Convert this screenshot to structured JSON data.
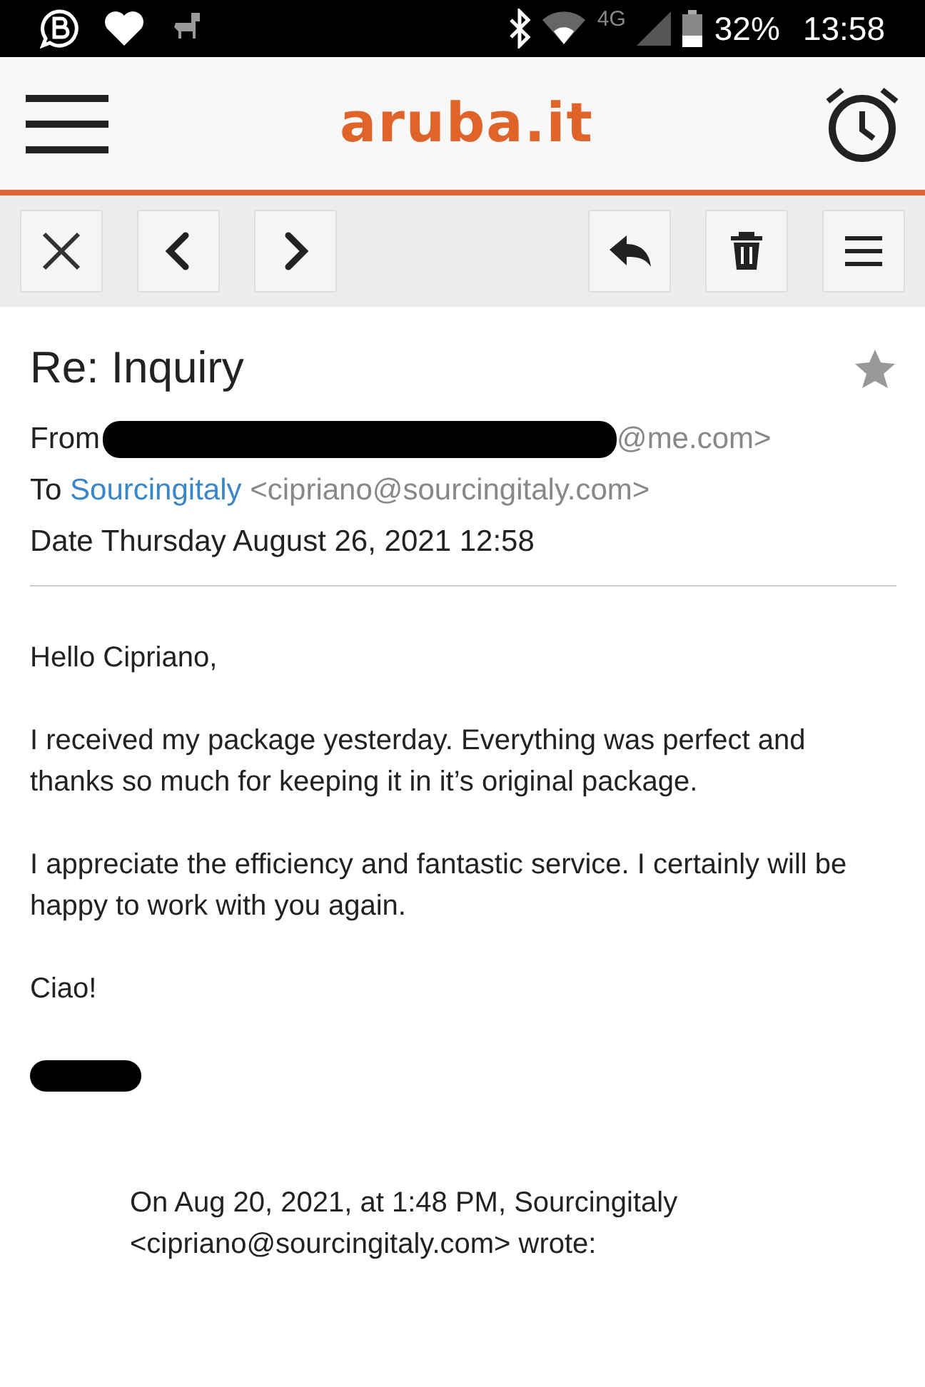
{
  "status_bar": {
    "battery": "32%",
    "time": "13:58",
    "network": "4G"
  },
  "header": {
    "logo": "aruba.it"
  },
  "toolbar": {
    "left": [
      {
        "kind": "close"
      },
      {
        "kind": "prev"
      },
      {
        "kind": "next"
      }
    ],
    "right": [
      {
        "kind": "reply"
      },
      {
        "kind": "delete"
      },
      {
        "kind": "menu"
      }
    ]
  },
  "message": {
    "subject": "Re: Inquiry",
    "starred": false,
    "from": {
      "label": "From",
      "address_tail": "@me.com>"
    },
    "to": {
      "label": "To",
      "name": "Sourcingitaly",
      "address": "<cipriano@sourcingitaly.com>"
    },
    "date": {
      "label": "Date",
      "value": "Thursday August 26, 2021 12:58"
    },
    "body": [
      "Hello Cipriano,",
      "I received my package yesterday. Everything was perfect and thanks so much for keeping it in it’s original package.",
      "I appreciate the efficiency and fantastic service. I certainly will be happy to work with you again.",
      "Ciao!"
    ],
    "quote": [
      "On Aug 20, 2021, at 1:48 PM, Sourcingitaly",
      "<cipriano@sourcingitaly.com> wrote:"
    ]
  }
}
